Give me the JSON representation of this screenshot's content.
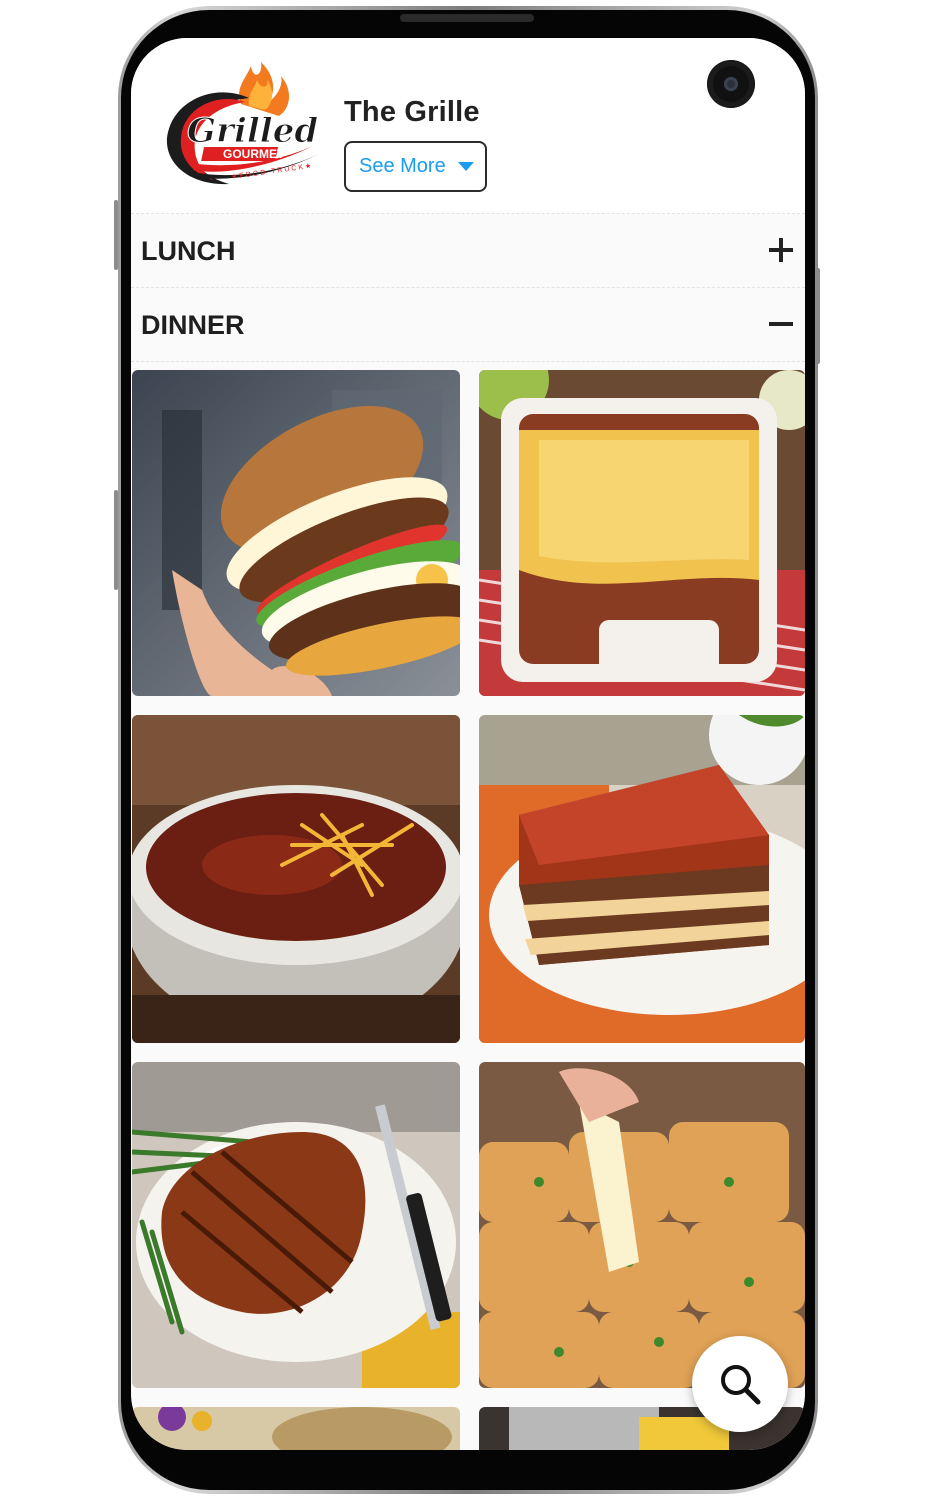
{
  "header": {
    "logo": {
      "brand_top": "Grilled",
      "brand_bottom": "GOURMET",
      "brand_sub": "FOOD TRUCK"
    },
    "restaurant_name": "The Grille",
    "see_more_label": "See More"
  },
  "sections": [
    {
      "label": "LUNCH",
      "state": "collapsed",
      "toggle_icon": "plus-icon"
    },
    {
      "label": "DINNER",
      "state": "expanded",
      "toggle_icon": "minus-icon"
    }
  ],
  "menu_images": [
    {
      "name": "burger-image"
    },
    {
      "name": "tamale-pie-image"
    },
    {
      "name": "chili-bowl-image"
    },
    {
      "name": "lasagna-image"
    },
    {
      "name": "pork-chop-image"
    },
    {
      "name": "pull-apart-bread-image"
    },
    {
      "name": "partial-image-7"
    },
    {
      "name": "partial-image-8"
    }
  ],
  "search_fab": {
    "icon": "search-icon"
  },
  "colors": {
    "accent_blue": "#1a9cf0",
    "logo_red": "#e02020",
    "logo_orange": "#f47a20",
    "text_dark": "#222222"
  }
}
